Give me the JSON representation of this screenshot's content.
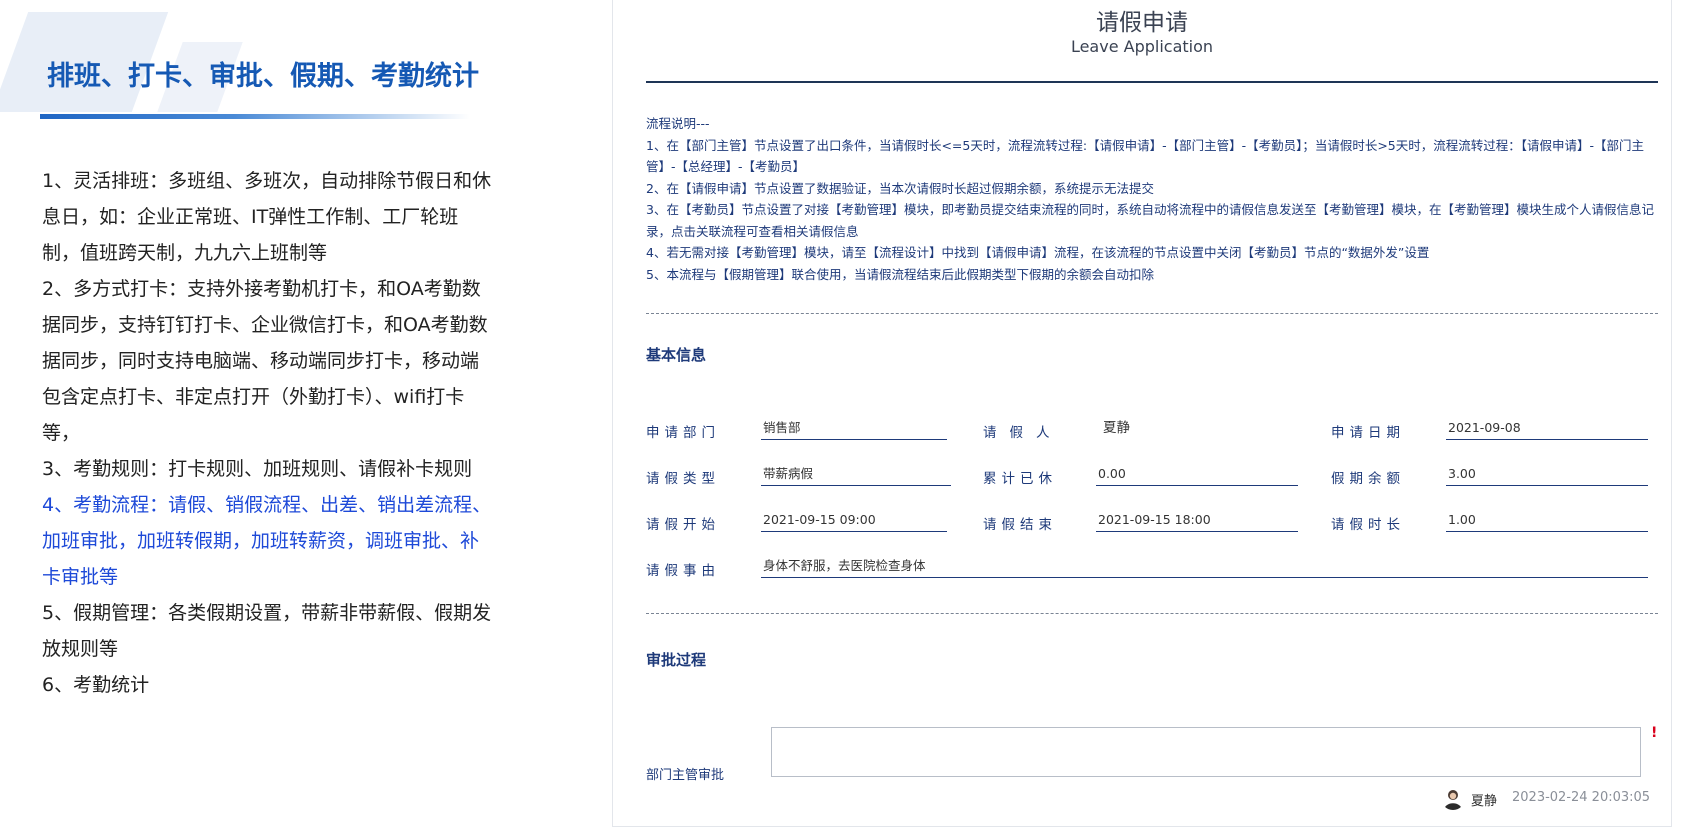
{
  "left": {
    "title": "排班、打卡、审批、假期、考勤统计",
    "features": [
      "1、灵活排班：多班组、多班次，自动排除节假日和休息日，如：企业正常班、IT弹性工作制、工厂轮班制，值班跨天制，九九六上班制等",
      "2、多方式打卡：支持外接考勤机打卡，和OA考勤数据同步，支持钉钉打卡、企业微信打卡，和OA考勤数据同步，同时支持电脑端、移动端同步打卡，移动端包含定点打卡、非定点打开（外勤打卡）、wifi打卡等，",
      "3、考勤规则：打卡规则、加班规则、请假补卡规则",
      "4、考勤流程：请假、销假流程、出差、销出差流程、加班审批，加班转假期，加班转薪资，调班审批、补卡审批等",
      "5、假期管理：各类假期设置，带薪非带薪假、假期发放规则等",
      "6、考勤统计"
    ],
    "highlight_color": "#1d49d8"
  },
  "form": {
    "title": "请假申请",
    "subtitle": "Leave Application",
    "process": {
      "heading": "流程说明---",
      "lines": [
        "1、在【部门主管】节点设置了出口条件，当请假时长<=5天时，流程流转过程:【请假申请】-【部门主管】-【考勤员】；当请假时长>5天时，流程流转过程：【请假申请】-【部门主管】-【总经理】-【考勤员】",
        "2、在【请假申请】节点设置了数据验证，当本次请假时长超过假期余额，系统提示无法提交",
        "3、在【考勤员】节点设置了对接【考勤管理】模块，即考勤员提交结束流程的同时，系统自动将流程中的请假信息发送至【考勤管理】模块，在【考勤管理】模块生成个人请假信息记录，点击关联流程可查看相关请假信息",
        "4、若无需对接【考勤管理】模块，请至【流程设计】中找到【请假申请】流程，在该流程的节点设置中关闭【考勤员】节点的“数据外发”设置",
        "5、本流程与【假期管理】联合使用，当请假流程结束后此假期类型下假期的余额会自动扣除"
      ]
    },
    "basic_info": {
      "title": "基本信息",
      "fields": {
        "department": {
          "label": "申请部门",
          "value": "销售部"
        },
        "applicant": {
          "label": "请假人",
          "value": "夏静"
        },
        "apply_date": {
          "label": "申请日期",
          "value": "2021-09-08"
        },
        "leave_type": {
          "label": "请假类型",
          "value": "带薪病假"
        },
        "accumulated": {
          "label": "累计已休",
          "value": "0.00"
        },
        "balance": {
          "label": "假期余额",
          "value": "3.00"
        },
        "start": {
          "label": "请假开始",
          "value": "2021-09-15 09:00"
        },
        "end": {
          "label": "请假结束",
          "value": "2021-09-15 18:00"
        },
        "duration": {
          "label": "请假时长",
          "value": "1.00"
        },
        "reason": {
          "label": "请假事由",
          "value": "身体不舒服，去医院检查身体"
        }
      }
    },
    "approval": {
      "title": "审批过程",
      "dept_manager_label": "部门主管审批",
      "required_mark": "!",
      "approver": "夏静",
      "time": "2023-02-24 20:03:05"
    }
  }
}
